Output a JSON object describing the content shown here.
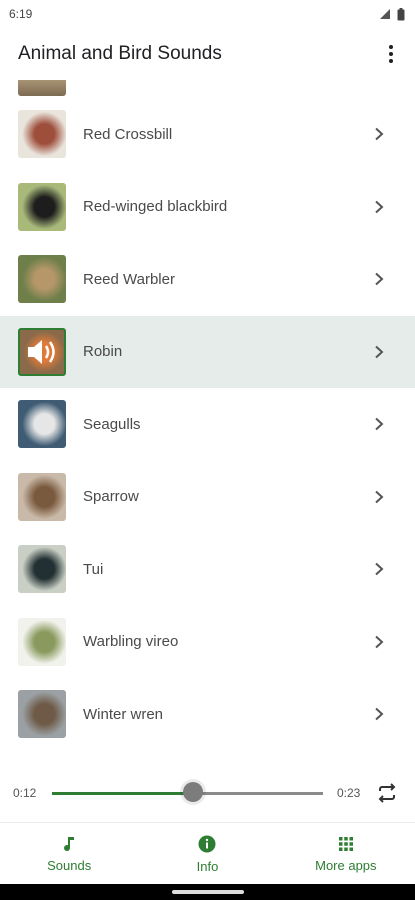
{
  "status_bar": {
    "time": "6:19",
    "icons": [
      "signal-icon",
      "battery-icon"
    ]
  },
  "app_bar": {
    "title": "Animal and Bird Sounds",
    "menu_icon": "more-vert-icon"
  },
  "list": {
    "items": [
      {
        "label": "Red Crossbill",
        "selected": false,
        "thumb_colors": [
          "#e9e4dc",
          "#9e4f3c"
        ]
      },
      {
        "label": "Red-winged blackbird",
        "selected": false,
        "thumb_colors": [
          "#a8b97a",
          "#1d1d1d"
        ]
      },
      {
        "label": "Reed Warbler",
        "selected": false,
        "thumb_colors": [
          "#6e7f4a",
          "#b5976a"
        ]
      },
      {
        "label": "Robin",
        "selected": true,
        "thumb_colors": [
          "#8a6a4a",
          "#e07a3a"
        ]
      },
      {
        "label": "Seagulls",
        "selected": false,
        "thumb_colors": [
          "#3f5c74",
          "#e6e6e6"
        ]
      },
      {
        "label": "Sparrow",
        "selected": false,
        "thumb_colors": [
          "#c9b9a8",
          "#7a5a3e"
        ]
      },
      {
        "label": "Tui",
        "selected": false,
        "thumb_colors": [
          "#c9cfc4",
          "#223033"
        ]
      },
      {
        "label": "Warbling vireo",
        "selected": false,
        "thumb_colors": [
          "#f1f2ec",
          "#8a9a5e"
        ]
      },
      {
        "label": "Winter wren",
        "selected": false,
        "thumb_colors": [
          "#9aa0a3",
          "#6e5a46"
        ]
      }
    ]
  },
  "player": {
    "current_time": "0:12",
    "total_time": "0:23",
    "progress": 0.52,
    "repeat_icon": "repeat-icon"
  },
  "bottom_nav": {
    "items": [
      {
        "label": "Sounds",
        "icon": "music-note-icon"
      },
      {
        "label": "Info",
        "icon": "info-icon"
      },
      {
        "label": "More apps",
        "icon": "grid-icon"
      }
    ]
  },
  "colors": {
    "accent": "#2e7d32",
    "selected_row": "#e6ecea"
  }
}
